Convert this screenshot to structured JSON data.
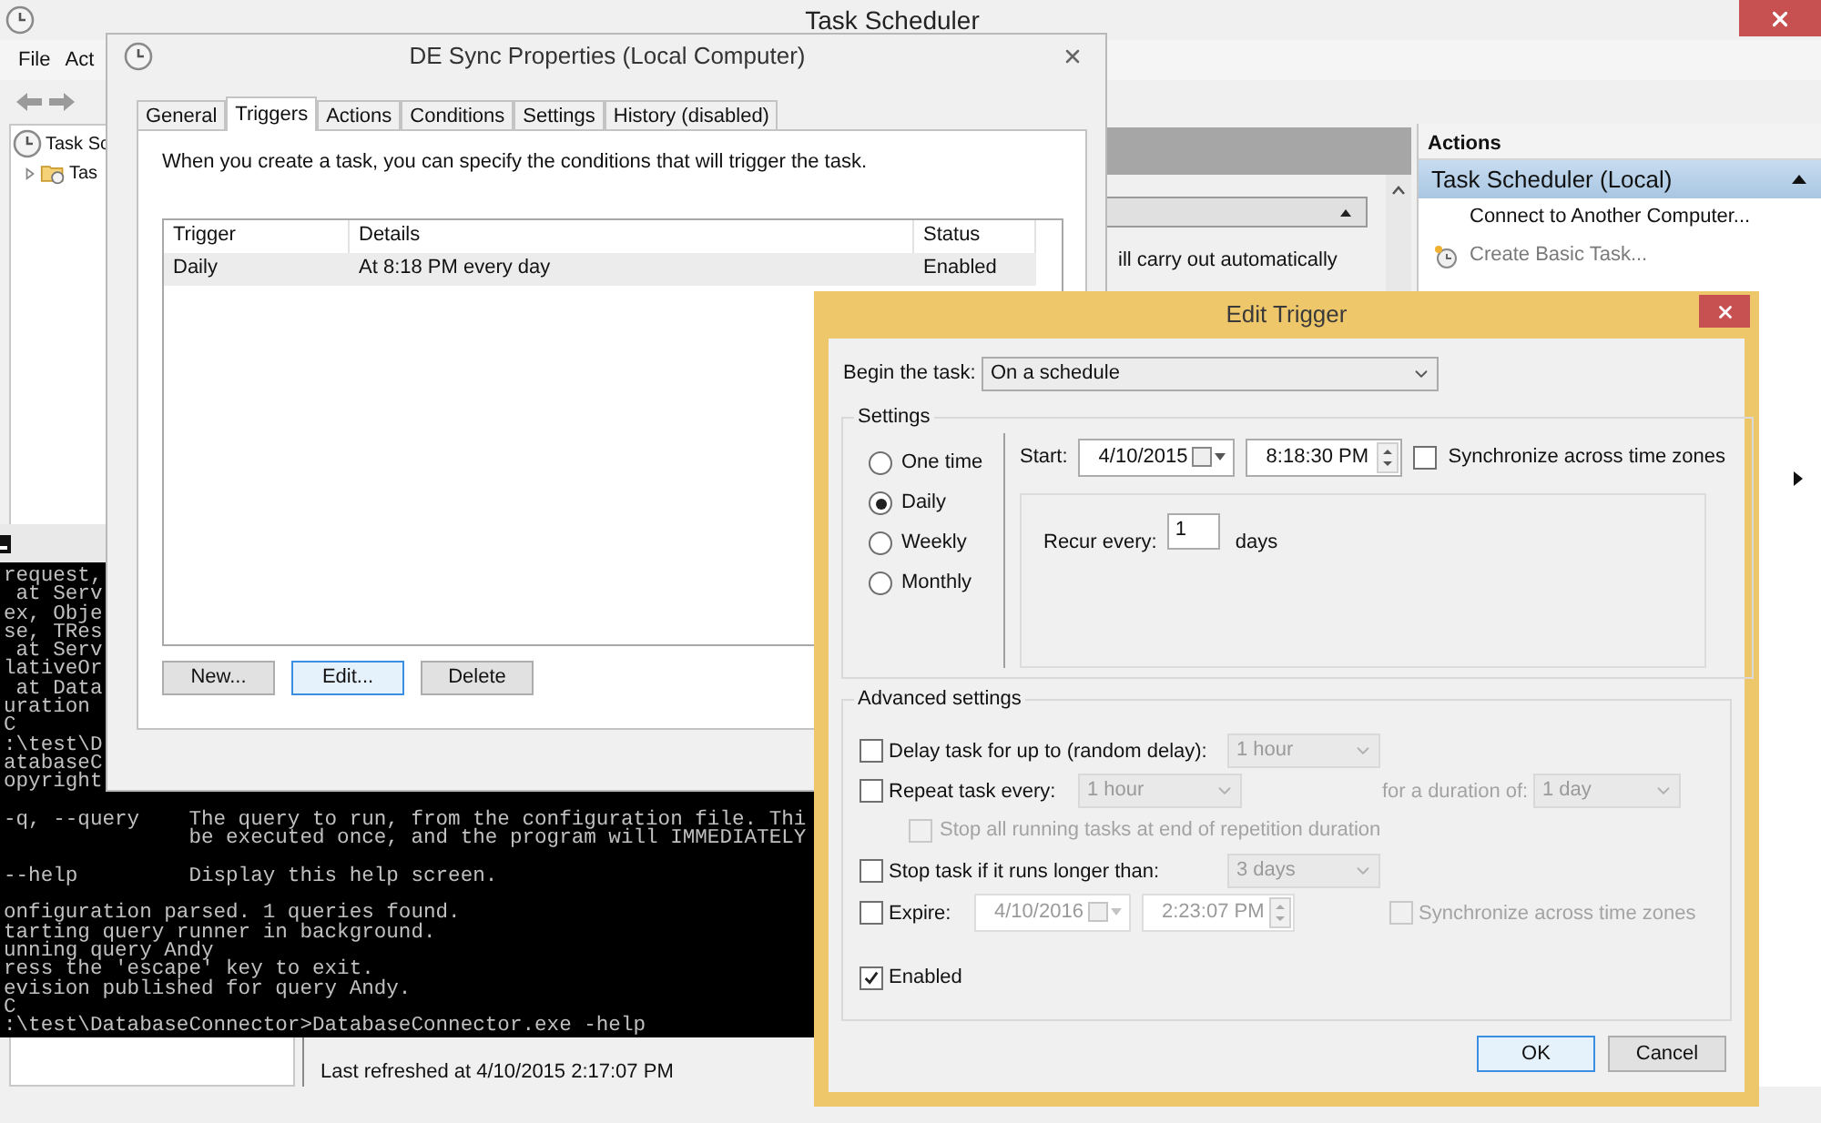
{
  "main_window": {
    "title": "Task Scheduler",
    "menu": [
      "File",
      "Act"
    ],
    "tree": [
      {
        "label": "Task Sc",
        "children": [
          {
            "label": "Tas",
            "expanded": false
          }
        ]
      }
    ],
    "center": {
      "description": "ill carry out automatically",
      "status": "Last refreshed at 4/10/2015 2:17:07 PM"
    },
    "actions_pane": {
      "title": "Actions",
      "group": "Task Scheduler (Local)",
      "items": [
        {
          "label": "Connect to Another Computer...",
          "disabled": false,
          "kind": "plain"
        },
        {
          "label": "Create Basic Task...",
          "disabled": true,
          "kind": "task"
        }
      ]
    }
  },
  "console": {
    "paragraphs": [
      [
        "request,",
        " at Serv",
        "ex, Obje",
        "se, TRes",
        " at Serv",
        "lativeOr",
        " at Data",
        "uration",
        "C",
        ":\\test\\D",
        "atabaseC",
        "opyright"
      ],
      [
        "-q, --query    The query to run, from the configuration file. Thi",
        "               be executed once, and the program will IMMEDIATELY"
      ],
      [
        "--help         Display this help screen."
      ],
      [
        "onfiguration parsed. 1 queries found.",
        "tarting query runner in background.",
        "unning query Andy",
        "ress the 'escape' key to exit.",
        "evision published for query Andy.",
        "C",
        ":\\test\\DatabaseConnector>DatabaseConnector.exe -help"
      ]
    ]
  },
  "properties_dialog": {
    "title": "DE Sync Properties (Local Computer)",
    "tabs": [
      {
        "label": "General",
        "selected": false
      },
      {
        "label": "Triggers",
        "selected": true
      },
      {
        "label": "Actions",
        "selected": false
      },
      {
        "label": "Conditions",
        "selected": false
      },
      {
        "label": "Settings",
        "selected": false
      },
      {
        "label": "History (disabled)",
        "selected": false
      }
    ],
    "intro": "When you create a task, you can specify the conditions that will trigger the task.",
    "table": {
      "columns": [
        "Trigger",
        "Details",
        "Status"
      ],
      "rows": [
        {
          "cells": [
            "Daily",
            "At 8:18 PM every day",
            "Enabled"
          ],
          "selected": true
        }
      ]
    },
    "buttons": [
      {
        "label": "New...",
        "focused": false
      },
      {
        "label": "Edit...",
        "focused": true
      },
      {
        "label": "Delete",
        "focused": false
      }
    ]
  },
  "edit_trigger": {
    "title": "Edit Trigger",
    "begin_label": "Begin the task:",
    "begin_value": "On a schedule",
    "settings_label": "Settings",
    "schedule_options": [
      {
        "label": "One time",
        "selected": false
      },
      {
        "label": "Daily",
        "selected": true
      },
      {
        "label": "Weekly",
        "selected": false
      },
      {
        "label": "Monthly",
        "selected": false
      }
    ],
    "start_label": "Start:",
    "start_date": "4/10/2015",
    "start_time": "8:18:30 PM",
    "sync": {
      "label": "Synchronize across time zones",
      "checked": false
    },
    "recur_label": "Recur every:",
    "recur_value": "1",
    "recur_unit": "days",
    "advanced_label": "Advanced settings",
    "delay": {
      "label": "Delay task for up to (random delay):",
      "checked": false,
      "value": "1 hour"
    },
    "repeat": {
      "label": "Repeat task every:",
      "checked": false,
      "value": "1 hour",
      "duration_label": "for a duration of:",
      "duration_value": "1 day"
    },
    "stop_all": {
      "label": "Stop all running tasks at end of repetition duration",
      "checked": false
    },
    "stop_long": {
      "label": "Stop task if it runs longer than:",
      "checked": false,
      "value": "3 days"
    },
    "expire": {
      "label": "Expire:",
      "checked": false,
      "date": "4/10/2016",
      "time": "2:23:07 PM",
      "sync_label": "Synchronize across time zones",
      "sync_checked": false
    },
    "enabled": {
      "label": "Enabled",
      "checked": true
    },
    "buttons": [
      {
        "label": "OK",
        "default": true
      },
      {
        "label": "Cancel",
        "default": false
      }
    ]
  }
}
